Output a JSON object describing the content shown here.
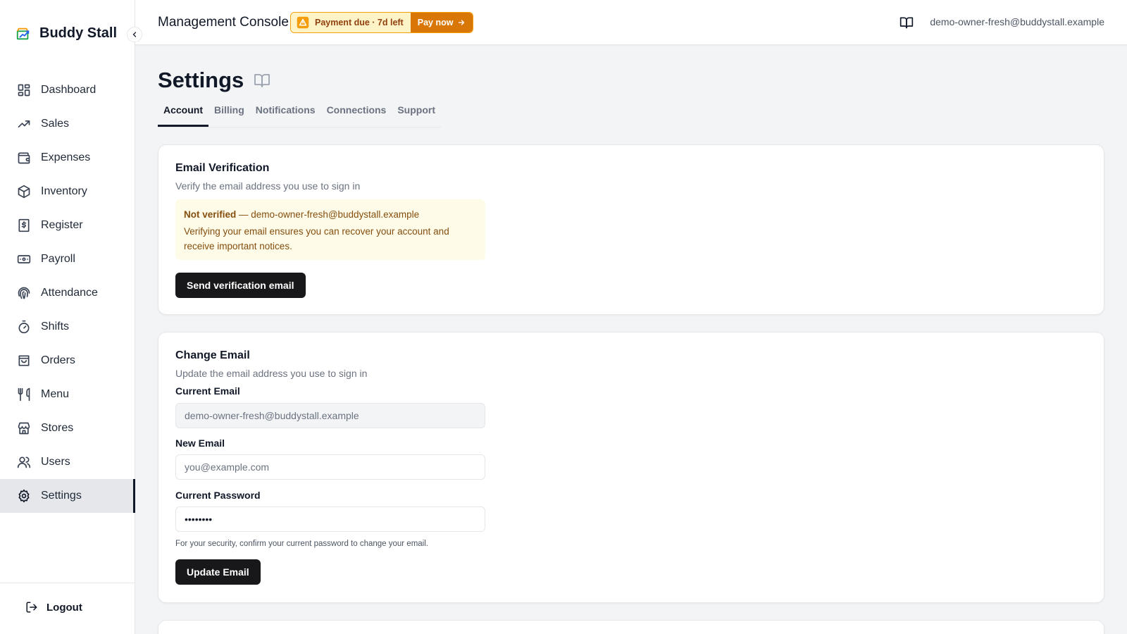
{
  "app": {
    "brand_name": "Buddy Stall",
    "console_title": "Management Console",
    "user_email": "demo-owner-fresh@buddystall.example"
  },
  "payment_banner": {
    "text": "Payment due · 7d left",
    "action_label": "Pay now"
  },
  "sidebar": {
    "items": [
      {
        "label": "Dashboard",
        "icon": "dashboard-icon"
      },
      {
        "label": "Sales",
        "icon": "trending-up-icon"
      },
      {
        "label": "Expenses",
        "icon": "wallet-icon"
      },
      {
        "label": "Inventory",
        "icon": "package-icon"
      },
      {
        "label": "Register",
        "icon": "receipt-icon"
      },
      {
        "label": "Payroll",
        "icon": "banknote-icon"
      },
      {
        "label": "Attendance",
        "icon": "fingerprint-icon"
      },
      {
        "label": "Shifts",
        "icon": "timer-icon"
      },
      {
        "label": "Orders",
        "icon": "shopping-bag-icon"
      },
      {
        "label": "Menu",
        "icon": "utensils-icon"
      },
      {
        "label": "Stores",
        "icon": "store-icon"
      },
      {
        "label": "Users",
        "icon": "users-icon"
      },
      {
        "label": "Settings",
        "icon": "gear-icon",
        "active": true
      }
    ],
    "logout_label": "Logout"
  },
  "page": {
    "title": "Settings",
    "tabs": [
      "Account",
      "Billing",
      "Notifications",
      "Connections",
      "Support"
    ],
    "active_tab": "Account"
  },
  "email_verification": {
    "title": "Email Verification",
    "subtitle": "Verify the email address you use to sign in",
    "status_label": "Not verified",
    "status_separator": " — ",
    "status_email": "demo-owner-fresh@buddystall.example",
    "message": "Verifying your email ensures you can recover your account and receive important notices.",
    "button_label": "Send verification email"
  },
  "change_email": {
    "title": "Change Email",
    "subtitle": "Update the email address you use to sign in",
    "current_email_label": "Current Email",
    "current_email_value": "demo-owner-fresh@buddystall.example",
    "new_email_label": "New Email",
    "new_email_placeholder": "you@example.com",
    "current_password_label": "Current Password",
    "current_password_value": "••••••••",
    "helper_text": "For your security, confirm your current password to change your email.",
    "button_label": "Update Email"
  },
  "colors": {
    "accent_dark": "#18181b",
    "warning_bg": "#fef3c7",
    "warning_action": "#d97706",
    "notice_bg": "#fefce8"
  }
}
